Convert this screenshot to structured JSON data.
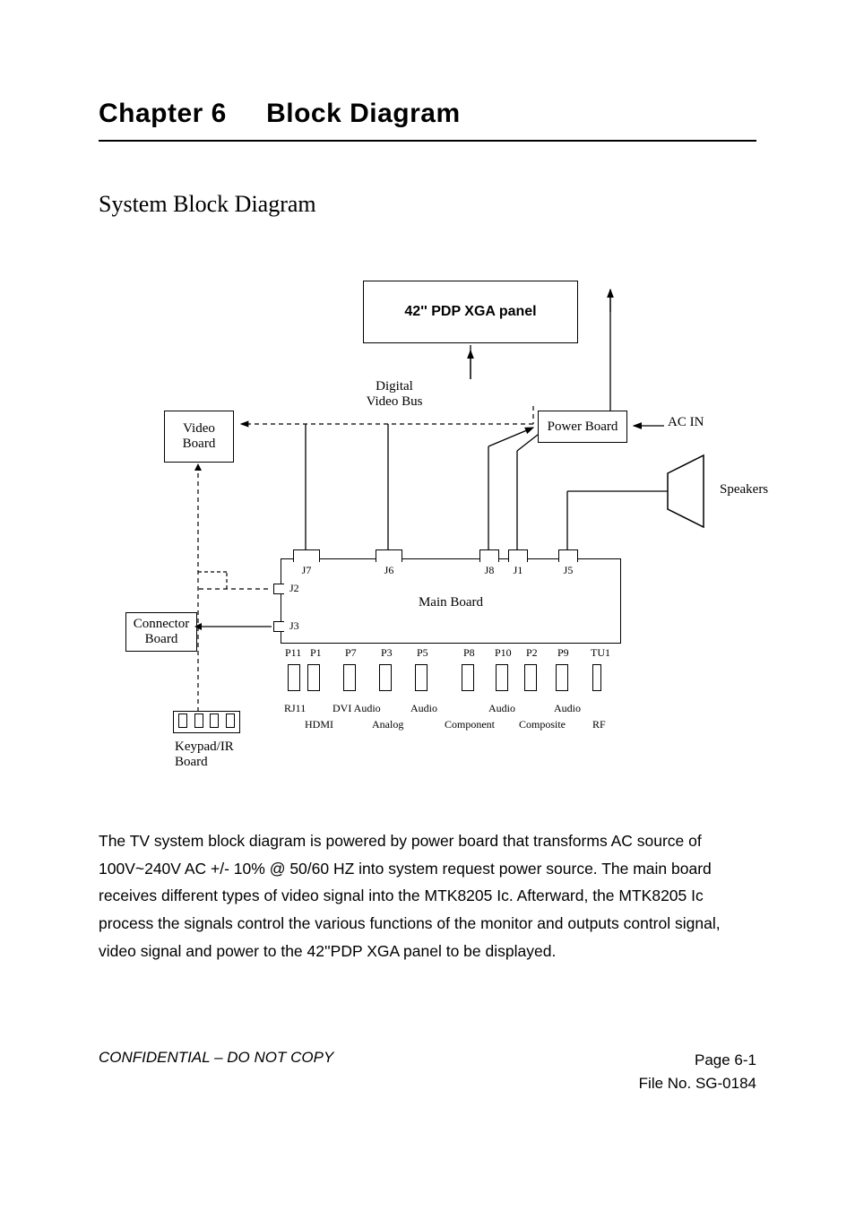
{
  "chapter": {
    "number": "Chapter 6",
    "title": "Block Diagram"
  },
  "section_title": "System Block Diagram",
  "diagram": {
    "panel_label": "42'' PDP XGA panel",
    "video_board": "Video\nBoard",
    "digital_video_bus": "Digital\nVideo Bus",
    "power_board": "Power Board",
    "ac_in": "AC IN",
    "speakers": "Speakers",
    "main_board": "Main Board",
    "connector_board": "Connector\nBoard",
    "keypad_ir": "Keypad/IR\nBoard",
    "top_connectors": {
      "j7": "J7",
      "j6": "J6",
      "j8": "J8",
      "j1": "J1",
      "j5": "J5"
    },
    "side_connectors": {
      "j2": "J2",
      "j3": "J3"
    },
    "bottom_connectors": {
      "p11": "P11",
      "p1": "P1",
      "p7": "P7",
      "p3": "P3",
      "p5": "P5",
      "p8": "P8",
      "p10": "P10",
      "p2": "P2",
      "p9": "P9",
      "tu1": "TU1"
    },
    "bottom_labels_row1": {
      "rj11": "RJ11",
      "dvi_audio": "DVI Audio",
      "audio1": "Audio",
      "audio2": "Audio",
      "audio3": "Audio"
    },
    "bottom_labels_row2": {
      "hdmi": "HDMI",
      "analog": "Analog",
      "component": "Component",
      "composite": "Composite",
      "rf": "RF"
    }
  },
  "body_text": "The TV system block diagram is powered by power board that transforms AC source of 100V~240V AC +/- 10% @ 50/60 HZ into system request power source. The main board receives different types of video signal into the MTK8205 Ic. Afterward, the MTK8205 Ic process the signals control the various functions of the monitor and outputs control signal, video signal and power to the 42''PDP XGA panel to be displayed.",
  "footer": {
    "confidential": "CONFIDENTIAL – DO NOT COPY",
    "page": "Page 6-1",
    "file_no": "File No. SG-0184"
  }
}
